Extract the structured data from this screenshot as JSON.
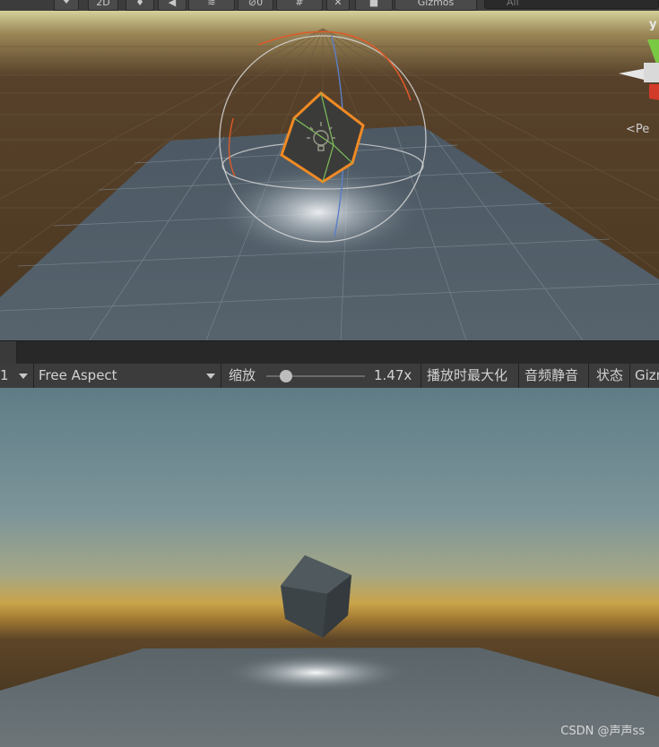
{
  "scene_toolbar": {
    "btn_2d": "2D",
    "hidden_count": "0",
    "gizmos_label": "Gizmos",
    "search_placeholder": "All"
  },
  "scene_view": {
    "axis_y_label": "y",
    "projection_label": "Pe",
    "colors": {
      "ground": "#4e3a22",
      "plane": "#4d5a66",
      "horizon": "#c9c38a",
      "selection": "#f08a24"
    }
  },
  "game_toolbar": {
    "display_label": "1",
    "aspect_label": "Free Aspect",
    "zoom_label": "缩放",
    "zoom_value": "1.47x",
    "zoom_fraction": 0.2,
    "maximize_label": "播放时最大化",
    "mute_label": "音频静音",
    "stats_label": "状态",
    "gizmos_label": "Gizm"
  },
  "game_view": {
    "watermark": "CSDN @声声ss",
    "colors": {
      "sky": "#6c8a95",
      "horizon": "#c59a3c",
      "ground": "#3f321f",
      "plane": "#5f686d"
    }
  }
}
